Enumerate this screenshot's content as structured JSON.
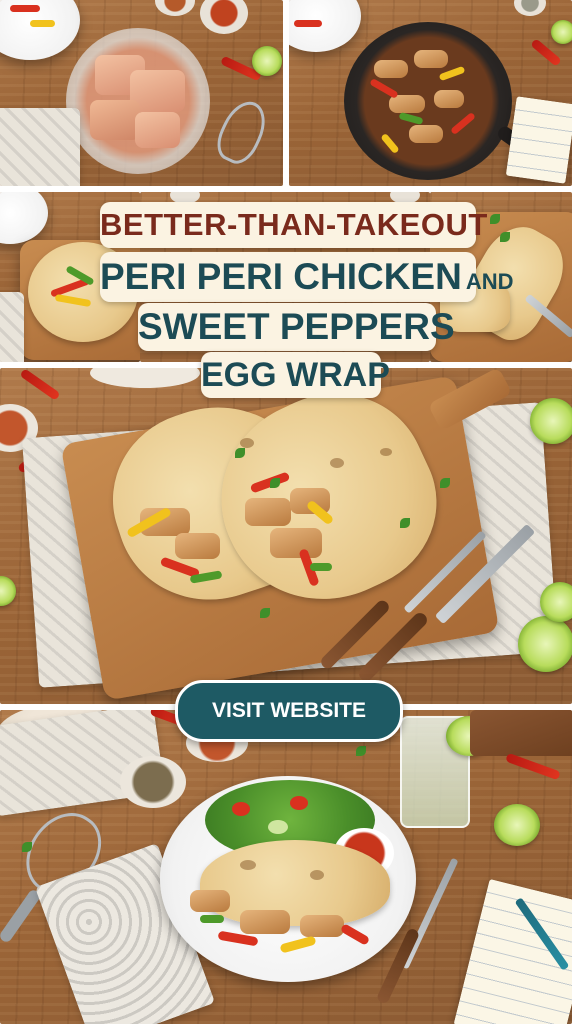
{
  "title": {
    "line1": "BETTER-THAN-TAKEOUT",
    "line2": "PERI PERI CHICKEN",
    "line2_conjunction": "AND",
    "line3": "SWEET PEPPERS",
    "line4": "EGG WRAP"
  },
  "cta": {
    "label": "VISIT WEBSITE"
  },
  "colors": {
    "title_top": "#7a2a1c",
    "title_main": "#1c4b55",
    "title_bg": "#fbf3e2",
    "button_bg": "#1e5a64",
    "button_text": "#ffffff"
  }
}
